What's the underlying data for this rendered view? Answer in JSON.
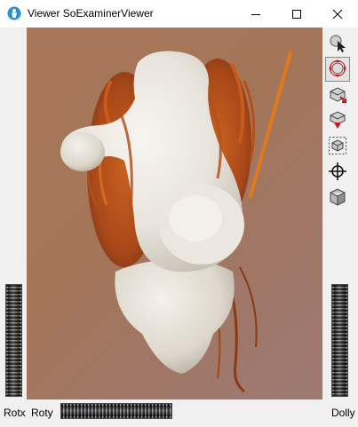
{
  "window": {
    "title": "Viewer SoExaminerViewer"
  },
  "icons": {
    "app": "inventor-app-icon",
    "minimize": "minimize-icon",
    "maximize": "maximize-icon",
    "close": "close-icon"
  },
  "toolbar": {
    "buttons": [
      {
        "icon": "pick-arrow-icon",
        "active": false
      },
      {
        "icon": "view-rotate-icon",
        "active": true
      },
      {
        "icon": "seek-point-icon",
        "active": false
      },
      {
        "icon": "home-view-icon",
        "active": false
      },
      {
        "icon": "view-all-icon",
        "active": false
      },
      {
        "icon": "crosshair-seek-icon",
        "active": false
      },
      {
        "icon": "projection-cube-icon",
        "active": false
      }
    ]
  },
  "wheels": {
    "rotx_label": "Rotx",
    "roty_label": "Roty",
    "dolly_label": "Dolly"
  },
  "colors": {
    "bone": "#e8e4dc",
    "tissue": "#b4511a",
    "background_top": "#a9765a",
    "background_bottom": "#9c7a73"
  }
}
